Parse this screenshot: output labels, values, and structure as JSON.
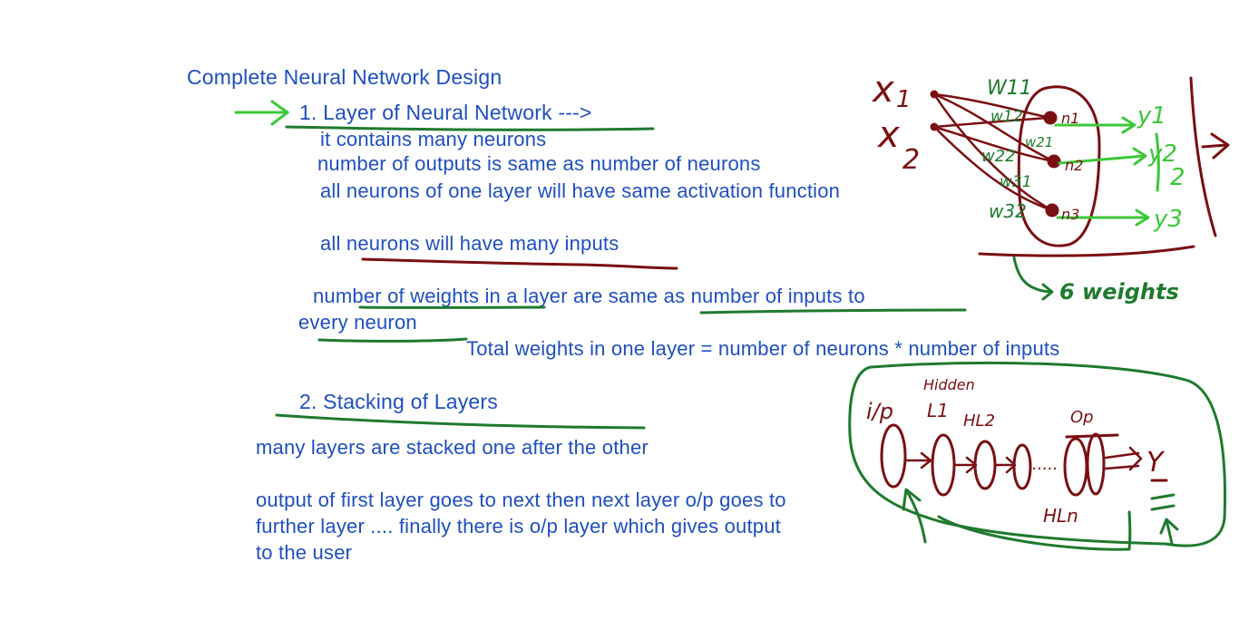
{
  "title": "Complete Neural Network Design",
  "section1": {
    "heading": "1. Layer of Neural Network --->",
    "lines": [
      "it contains many neurons",
      "number of outputs is same as number of neurons",
      "all neurons of one layer will have same activation function",
      "all neurons will have many inputs",
      "number of weights in a layer are same as number of inputs to",
      "every neuron",
      "Total weights in one layer = number of neurons * number of inputs"
    ]
  },
  "section2": {
    "heading": "2. Stacking of Layers",
    "lines": [
      "many layers are stacked one after the other",
      "output of first layer goes to next then next layer o/p goes to",
      "further layer .... finally there is o/p layer which gives output",
      "to the user"
    ]
  },
  "diagram1": {
    "inputs": [
      "x",
      "x"
    ],
    "input_subscripts": [
      "1",
      "2"
    ],
    "weight_labels": [
      "W11",
      "w12",
      "w21",
      "w22",
      "w31",
      "w32"
    ],
    "neuron_labels": [
      "n1",
      "n2",
      "n3"
    ],
    "outputs": [
      "y1",
      "y2",
      "y3"
    ],
    "output_group": "y",
    "output_group_subscript": "2",
    "weights_note": "6 weights"
  },
  "diagram2": {
    "input_label": "i/p",
    "hidden_label": "Hidden",
    "layer_labels": [
      "L1",
      "HL2"
    ],
    "output_layer_label": "Op",
    "last_hidden_label": "HLn",
    "output_symbol": "Y",
    "dots": "....."
  },
  "colors": {
    "text_blue": "#1f4fbf",
    "ink_maroon": "#7a0f12",
    "ink_green_dark": "#1f7a2e",
    "ink_green_bright": "#3cc83a"
  }
}
